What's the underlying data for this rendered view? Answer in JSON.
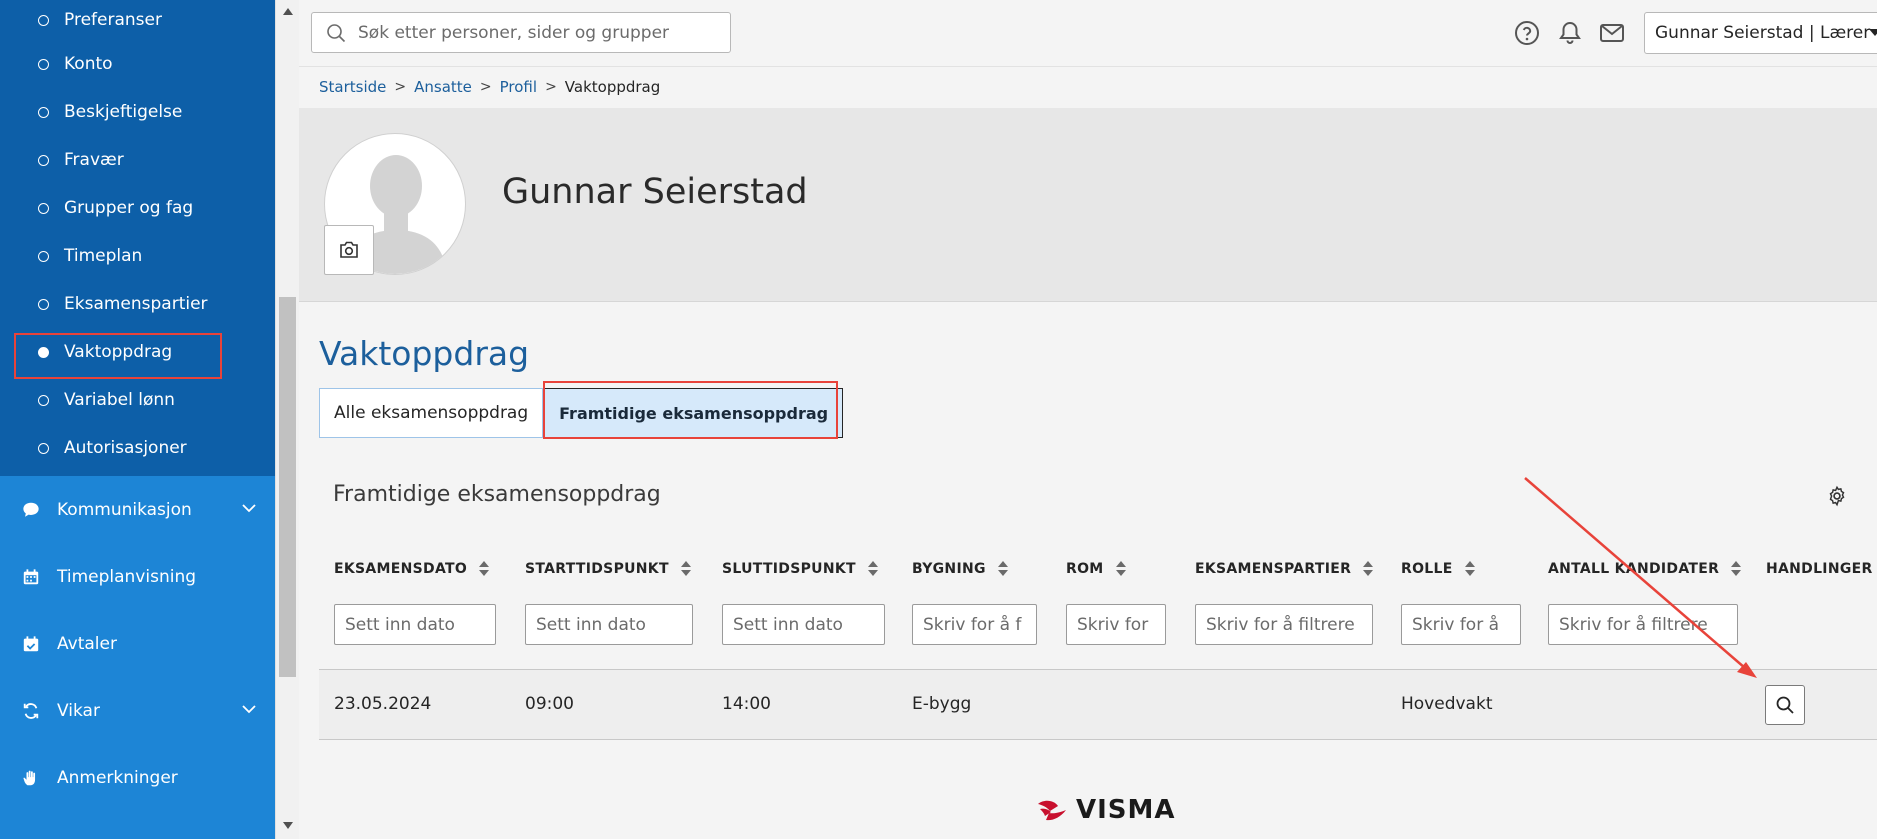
{
  "sidebar": {
    "sub_items": [
      {
        "label": "Preferanser",
        "active": false
      },
      {
        "label": "Konto",
        "active": false
      },
      {
        "label": "Beskjeftigelse",
        "active": false
      },
      {
        "label": "Fravær",
        "active": false
      },
      {
        "label": "Grupper og fag",
        "active": false
      },
      {
        "label": "Timeplan",
        "active": false
      },
      {
        "label": "Eksamenspartier",
        "active": false
      },
      {
        "label": "Vaktoppdrag",
        "active": true
      },
      {
        "label": "Variabel lønn",
        "active": false
      },
      {
        "label": "Autorisasjoner",
        "active": false
      }
    ],
    "main_items": [
      {
        "label": "Kommunikasjon",
        "icon": "chat-bubble-icon",
        "expandable": true
      },
      {
        "label": "Timeplanvisning",
        "icon": "calendar-icon",
        "expandable": false
      },
      {
        "label": "Avtaler",
        "icon": "calendar-check-icon",
        "expandable": false
      },
      {
        "label": "Vikar",
        "icon": "swap-arrows-icon",
        "expandable": true
      },
      {
        "label": "Anmerkninger",
        "icon": "hand-icon",
        "expandable": false
      }
    ]
  },
  "topbar": {
    "search_placeholder": "Søk etter personer, sider og grupper",
    "user_label": "Gunnar Seierstad | Lærer"
  },
  "breadcrumb": {
    "items": [
      "Startside",
      "Ansatte",
      "Profil"
    ],
    "current": "Vaktoppdrag"
  },
  "profile": {
    "name": "Gunnar Seierstad"
  },
  "page": {
    "title": "Vaktoppdrag",
    "tabs": [
      {
        "label": "Alle eksamensoppdrag",
        "active": false
      },
      {
        "label": "Framtidige eksamensoppdrag",
        "active": true
      }
    ],
    "panel_title": "Framtidige eksamensoppdrag"
  },
  "table": {
    "columns": [
      {
        "label": "EKSAMENSDATO",
        "sortable": true,
        "filter_placeholder": "Sett inn dato"
      },
      {
        "label": "STARTTIDSPUNKT",
        "sortable": true,
        "filter_placeholder": "Sett inn dato"
      },
      {
        "label": "SLUTTIDSPUNKT",
        "sortable": true,
        "filter_placeholder": "Sett inn dato"
      },
      {
        "label": "BYGNING",
        "sortable": true,
        "filter_placeholder": "Skriv for å f"
      },
      {
        "label": "ROM",
        "sortable": true,
        "filter_placeholder": "Skriv for"
      },
      {
        "label": "EKSAMENSPARTIER",
        "sortable": true,
        "filter_placeholder": "Skriv for å filtrere"
      },
      {
        "label": "ROLLE",
        "sortable": true,
        "filter_placeholder": "Skriv for å"
      },
      {
        "label": "ANTALL KANDIDATER",
        "sortable": true,
        "filter_placeholder": "Skriv for å filtrere"
      },
      {
        "label": "HANDLINGER",
        "sortable": false,
        "filter_placeholder": ""
      }
    ],
    "rows": [
      {
        "eksamensdato": "23.05.2024",
        "start": "09:00",
        "slutt": "14:00",
        "bygning": "E-bygg",
        "rom": "",
        "eksamenspartier": "",
        "rolle": "Hovedvakt",
        "antall_kandidater": ""
      }
    ]
  },
  "footer": {
    "logo_text": "VISMA"
  },
  "colors": {
    "sidebar_sub_bg": "#0d5fa8",
    "sidebar_main_bg": "#1d85d6",
    "accent_blue": "#1c5f9c",
    "annotation_red": "#e8433a",
    "visma_red": "#c8102e"
  }
}
